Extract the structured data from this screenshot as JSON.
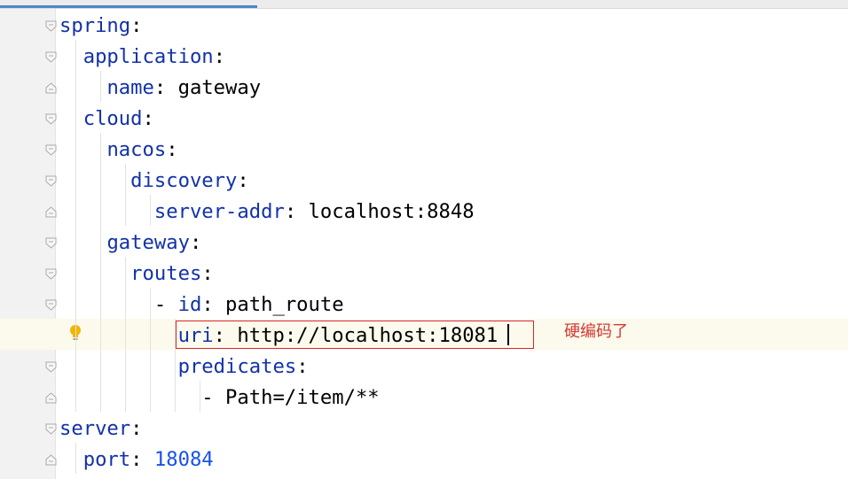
{
  "editor": {
    "lines": [
      {
        "indent": 0,
        "key": "spring",
        "sep": ":",
        "value": "",
        "value_type": "none"
      },
      {
        "indent": 1,
        "key": "application",
        "sep": ":",
        "value": "",
        "value_type": "none"
      },
      {
        "indent": 2,
        "key": "name",
        "sep": ":",
        "value": " gateway",
        "value_type": "str"
      },
      {
        "indent": 1,
        "key": "cloud",
        "sep": ":",
        "value": "",
        "value_type": "none"
      },
      {
        "indent": 2,
        "key": "nacos",
        "sep": ":",
        "value": "",
        "value_type": "none"
      },
      {
        "indent": 3,
        "key": "discovery",
        "sep": ":",
        "value": "",
        "value_type": "none"
      },
      {
        "indent": 4,
        "key": "server-addr",
        "sep": ":",
        "value": " localhost:8848",
        "value_type": "str"
      },
      {
        "indent": 2,
        "key": "gateway",
        "sep": ":",
        "value": "",
        "value_type": "none"
      },
      {
        "indent": 3,
        "key": "routes",
        "sep": ":",
        "value": "",
        "value_type": "none"
      },
      {
        "indent": 4,
        "prefix": "- ",
        "key": "id",
        "sep": ":",
        "value": " path_route",
        "value_type": "str"
      },
      {
        "indent": 5,
        "key": "uri",
        "sep": ":",
        "value": " http://localhost:18081",
        "value_type": "str"
      },
      {
        "indent": 5,
        "key": "predicates",
        "sep": ":",
        "value": "",
        "value_type": "none"
      },
      {
        "indent": 6,
        "prefix": "- ",
        "key": "",
        "sep": "",
        "value": "Path=/item/**",
        "value_type": "str"
      },
      {
        "indent": 0,
        "key": "server",
        "sep": ":",
        "value": "",
        "value_type": "none"
      },
      {
        "indent": 1,
        "key": "port",
        "sep": ":",
        "value": " 18084",
        "value_type": "num"
      }
    ],
    "highlighted_line": 11
  },
  "annotation": {
    "note": "硬编码了",
    "color": "#d23a33"
  },
  "colors": {
    "key": "#1232a8",
    "number": "#1750eb",
    "text": "#000000",
    "gutter": "#f2f2f2",
    "highlight": "#fcfaed"
  },
  "icons": {
    "intention": "lightbulb-icon",
    "fold_open": "fold-open-icon",
    "fold_close": "fold-close-icon"
  }
}
